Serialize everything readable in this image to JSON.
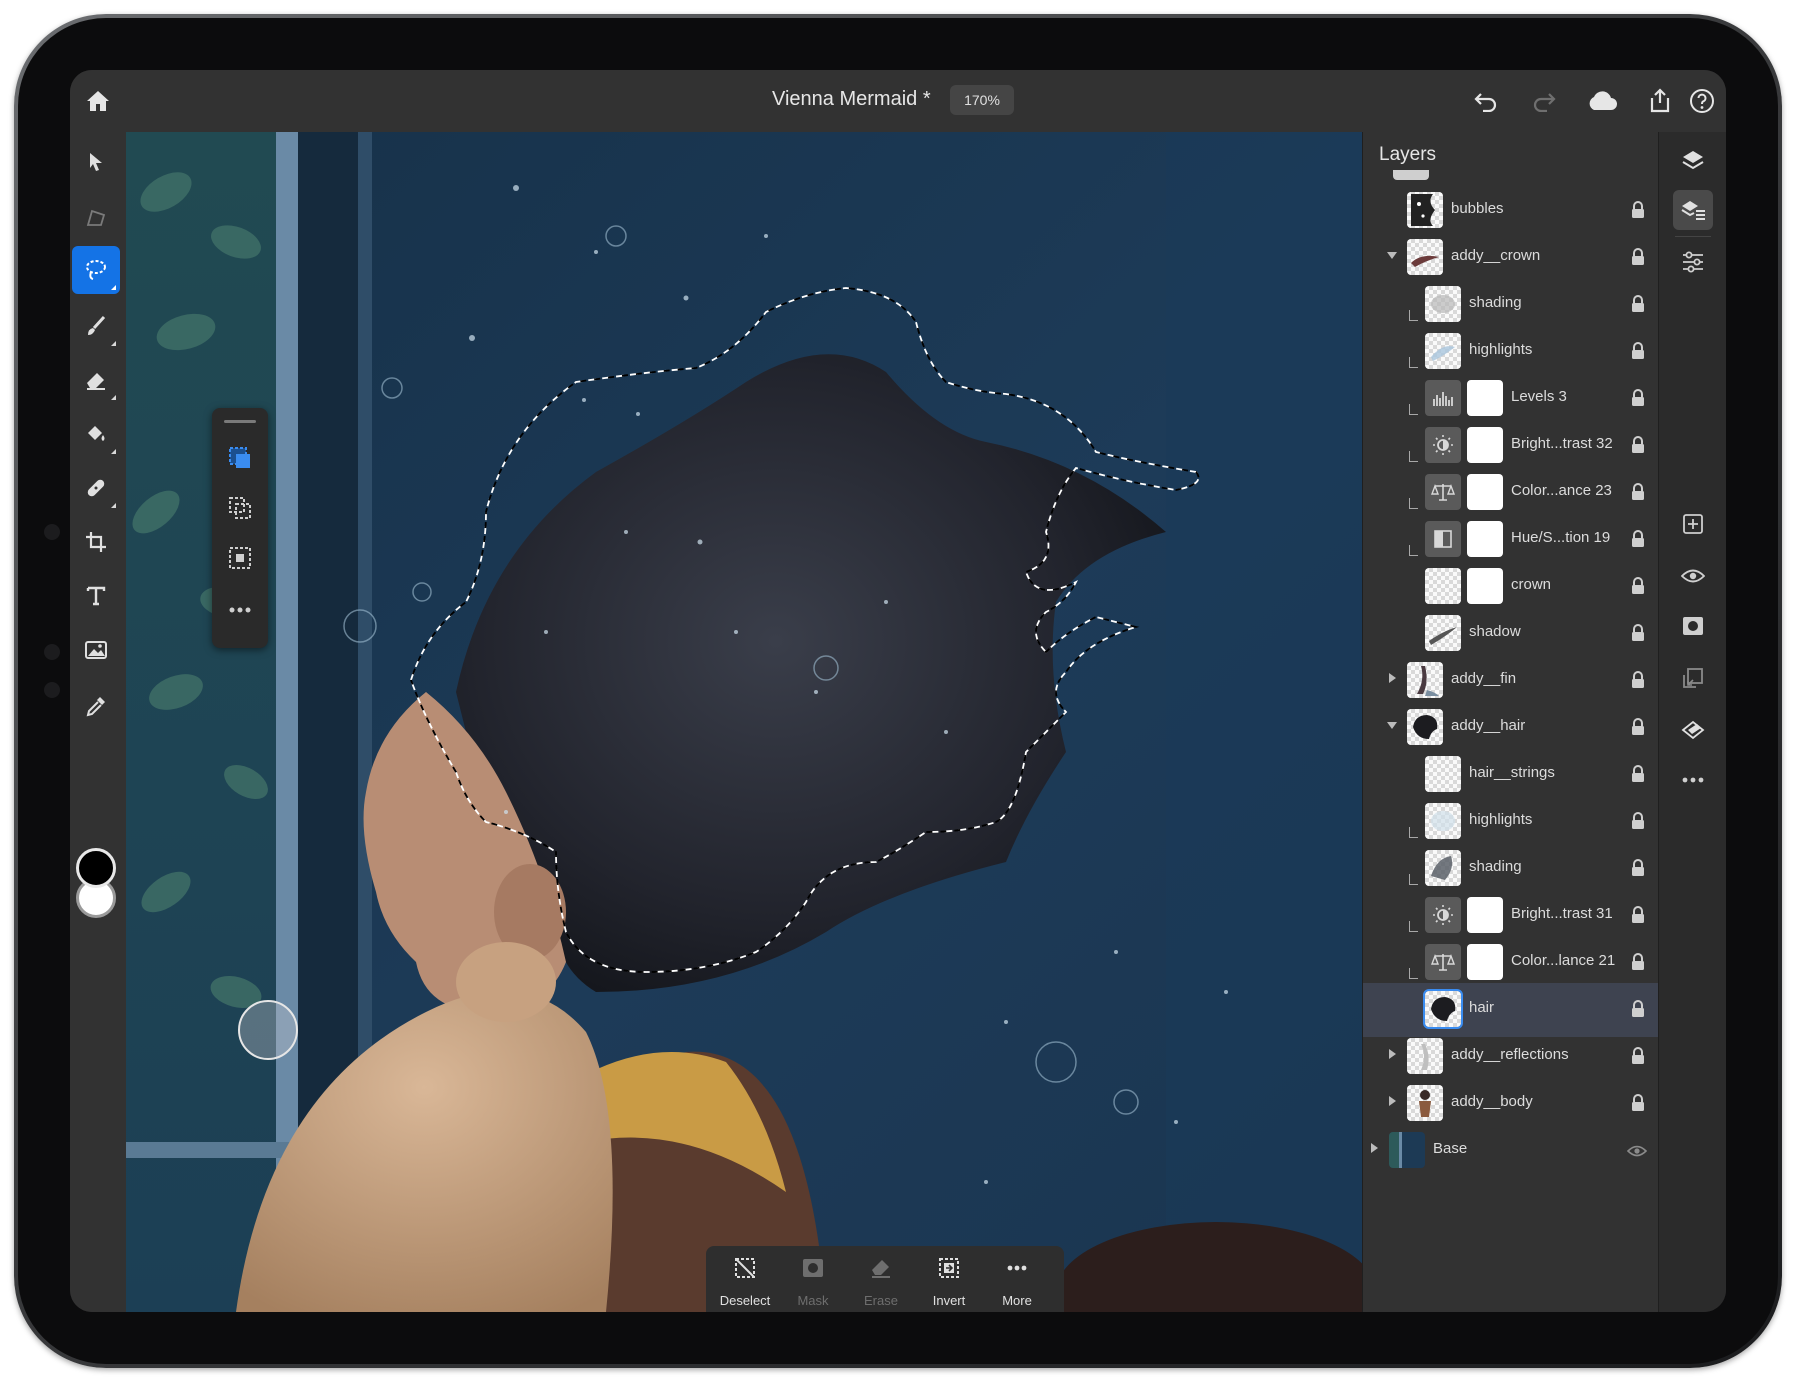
{
  "app": {
    "doc_title": "Vienna Mermaid *",
    "zoom": "170%"
  },
  "topbar": {
    "left_icons": [
      "home-icon"
    ],
    "right_icons": [
      "undo-icon",
      "redo-icon",
      "cloud-icon",
      "share-icon",
      "help-icon"
    ]
  },
  "left_toolbar": {
    "tools": [
      "select-arrow-icon",
      "transform-icon",
      "lasso-icon",
      "brush-icon",
      "eraser-icon",
      "fill-bucket-icon",
      "healing-brush-icon",
      "crop-icon",
      "type-icon",
      "place-image-icon",
      "eyedropper-icon"
    ],
    "active_tool": "lasso-icon",
    "foreground_color": "#000000",
    "background_color": "#ffffff"
  },
  "selection_flyout": {
    "items": [
      "new-selection-icon",
      "add-selection-icon",
      "subtract-selection-icon",
      "more-icon"
    ],
    "active_item": "new-selection-icon"
  },
  "bottom_toolbar": {
    "items": [
      {
        "label": "Deselect",
        "enabled": true,
        "icon": "deselect-icon"
      },
      {
        "label": "Mask",
        "enabled": false,
        "icon": "mask-icon"
      },
      {
        "label": "Erase",
        "enabled": false,
        "icon": "erase-icon"
      },
      {
        "label": "Invert",
        "enabled": true,
        "icon": "invert-icon"
      },
      {
        "label": "More",
        "enabled": true,
        "icon": "more-icon"
      }
    ]
  },
  "layers_panel": {
    "title": "Layers",
    "layers": [
      {
        "name": "bubbles",
        "depth": 0,
        "kind": "pixel",
        "expand": "none"
      },
      {
        "name": "addy__crown",
        "depth": 0,
        "kind": "group",
        "expand": "open"
      },
      {
        "name": "shading",
        "depth": 1,
        "kind": "pixel",
        "clipped": true
      },
      {
        "name": "highlights",
        "depth": 1,
        "kind": "pixel",
        "clipped": true
      },
      {
        "name": "Levels 3",
        "depth": 1,
        "kind": "adjustment",
        "adj_icon": "levels-icon",
        "clipped": true
      },
      {
        "name": "Bright...trast 32",
        "depth": 1,
        "kind": "adjustment",
        "adj_icon": "brightness-icon",
        "clipped": true
      },
      {
        "name": "Color...ance 23",
        "depth": 1,
        "kind": "adjustment",
        "adj_icon": "color-balance-icon",
        "clipped": true
      },
      {
        "name": "Hue/S...tion 19",
        "depth": 1,
        "kind": "adjustment",
        "adj_icon": "hue-saturation-icon",
        "clipped": true
      },
      {
        "name": "crown",
        "depth": 1,
        "kind": "masked",
        "clipped": false
      },
      {
        "name": "shadow",
        "depth": 1,
        "kind": "pixel",
        "clipped": false
      },
      {
        "name": "addy__fin",
        "depth": 0,
        "kind": "group",
        "expand": "closed"
      },
      {
        "name": "addy__hair",
        "depth": 0,
        "kind": "group",
        "expand": "open"
      },
      {
        "name": "hair__strings",
        "depth": 1,
        "kind": "pixel",
        "clipped": false
      },
      {
        "name": "highlights",
        "depth": 1,
        "kind": "pixel",
        "clipped": true
      },
      {
        "name": "shading",
        "depth": 1,
        "kind": "pixel",
        "clipped": true
      },
      {
        "name": "Bright...trast 31",
        "depth": 1,
        "kind": "adjustment",
        "adj_icon": "brightness-icon",
        "clipped": true
      },
      {
        "name": "Color...lance 21",
        "depth": 1,
        "kind": "adjustment",
        "adj_icon": "color-balance-icon",
        "clipped": true
      },
      {
        "name": "hair",
        "depth": 1,
        "kind": "pixel",
        "clipped": false,
        "selected": true
      },
      {
        "name": "addy__reflections",
        "depth": 0,
        "kind": "group",
        "expand": "closed"
      },
      {
        "name": "addy__body",
        "depth": 0,
        "kind": "group",
        "expand": "closed"
      },
      {
        "name": "Base",
        "depth": 0,
        "kind": "group",
        "expand": "closed",
        "visibility_icon": "eye-icon"
      }
    ]
  },
  "right_rail": {
    "items": [
      "layers-icon",
      "layer-properties-icon",
      "adjustments-icon",
      "add-layer-icon",
      "visibility-icon",
      "add-mask-icon",
      "clipping-icon",
      "fill-layer-icon",
      "more-icon"
    ],
    "active_item": "layer-properties-icon"
  },
  "colors": {
    "accent": "#1473e6",
    "panel": "#323232",
    "canvas_water": "#1d3a55"
  }
}
